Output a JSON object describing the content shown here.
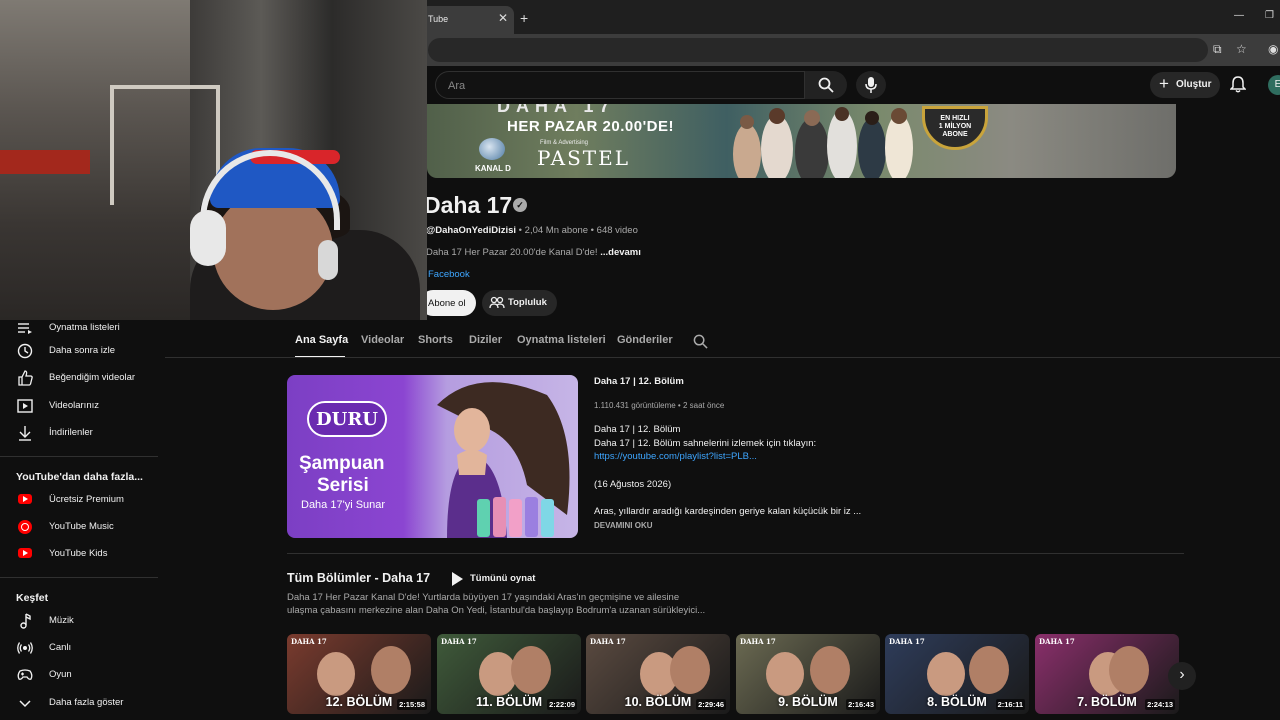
{
  "browser": {
    "tab_title": "Tube",
    "tab_close": "✕",
    "new_tab": "+"
  },
  "header": {
    "search_placeholder": "Ara",
    "create_label": "Oluştur",
    "avatar_letter": "E"
  },
  "banner": {
    "top_text": "DAHA 17",
    "schedule": "HER PAZAR 20.00'DE!",
    "network": "KANAL D",
    "producer_small": "Film & Advertising",
    "producer": "PASTEL",
    "badge": [
      "EN HIZLI",
      "1 MİLYON",
      "ABONE"
    ]
  },
  "channel": {
    "name": "Daha 17",
    "handle": "@DahaOnYediDizisi",
    "subscribers": "2,04 Mn abone",
    "videos": "648 video",
    "description": "Daha 17 Her Pazar 20.00'de Kanal D'de!",
    "more": "...devamı",
    "link": "Facebook",
    "subscribe": "Abone ol",
    "community": "Topluluk"
  },
  "sidebar": {
    "items_top": [
      {
        "label": "Oynatma listeleri",
        "icon": "playlist-icon"
      },
      {
        "label": "Daha sonra izle",
        "icon": "clock-icon"
      },
      {
        "label": "Beğendiğim videolar",
        "icon": "thumbs-up-icon"
      },
      {
        "label": "Videolarınız",
        "icon": "video-icon"
      },
      {
        "label": "İndirilenler",
        "icon": "download-icon"
      }
    ],
    "more_section": "YouTube'dan daha fazla...",
    "more_items": [
      {
        "label": "Ücretsiz Premium",
        "icon": "youtube-premium-icon"
      },
      {
        "label": "YouTube Music",
        "icon": "youtube-music-icon"
      },
      {
        "label": "YouTube Kids",
        "icon": "youtube-kids-icon"
      }
    ],
    "explore_section": "Keşfet",
    "explore_items": [
      {
        "label": "Müzik",
        "icon": "music-note-icon"
      },
      {
        "label": "Canlı",
        "icon": "live-icon"
      },
      {
        "label": "Oyun",
        "icon": "gamepad-icon"
      },
      {
        "label": "Daha fazla göster",
        "icon": "chevron-down-icon"
      }
    ]
  },
  "tabs": [
    "Ana Sayfa",
    "Videolar",
    "Shorts",
    "Diziler",
    "Oynatma listeleri",
    "Gönderiler"
  ],
  "featured": {
    "thumb_logo": "DURU",
    "thumb_line1": "Şampuan",
    "thumb_line2": "Serisi",
    "thumb_line3": "Daha 17'yi Sunar",
    "title": "Daha 17 | 12. Bölüm",
    "views": "1.110.431 görüntüleme",
    "age": "2 saat önce",
    "desc1": "Daha 17 | 12. Bölüm",
    "desc2": "Daha 17 | 12. Bölüm sahnelerini izlemek için tıklayın:",
    "link": "https://youtube.com/playlist?list=PLB...",
    "date": "(16 Ağustos 2026)",
    "desc3": "Aras, yıllardır aradığı kardeşinden geriye kalan küçücük bir iz ...",
    "more": "DEVAMINI OKU"
  },
  "shelf": {
    "title": "Tüm Bölümler - Daha 17",
    "play_all": "Tümünü oynat",
    "desc1": "Daha 17 Her Pazar Kanal D'de! Yurtlarda büyüyen 17 yaşındaki Aras'ın geçmişine ve ailesine",
    "desc2": "ulaşma çabasını merkezine alan Daha On Yedi, İstanbul'da başlayıp Bodrum'a uzanan sürükleyici...",
    "episode_logo": "DAHA 17",
    "episodes": [
      {
        "label": "12. BÖLÜM",
        "duration": "2:15:58",
        "color": "#7a3b2e"
      },
      {
        "label": "11. BÖLÜM",
        "duration": "2:22:09",
        "color": "#3f5a3a"
      },
      {
        "label": "10. BÖLÜM",
        "duration": "2:29:46",
        "color": "#5a4a40"
      },
      {
        "label": "9. BÖLÜM",
        "duration": "2:16:43",
        "color": "#6b6a52"
      },
      {
        "label": "8. BÖLÜM",
        "duration": "2:16:11",
        "color": "#2e3c5a"
      },
      {
        "label": "7. BÖLÜM",
        "duration": "2:24:13",
        "color": "#8a2f6b"
      }
    ]
  }
}
